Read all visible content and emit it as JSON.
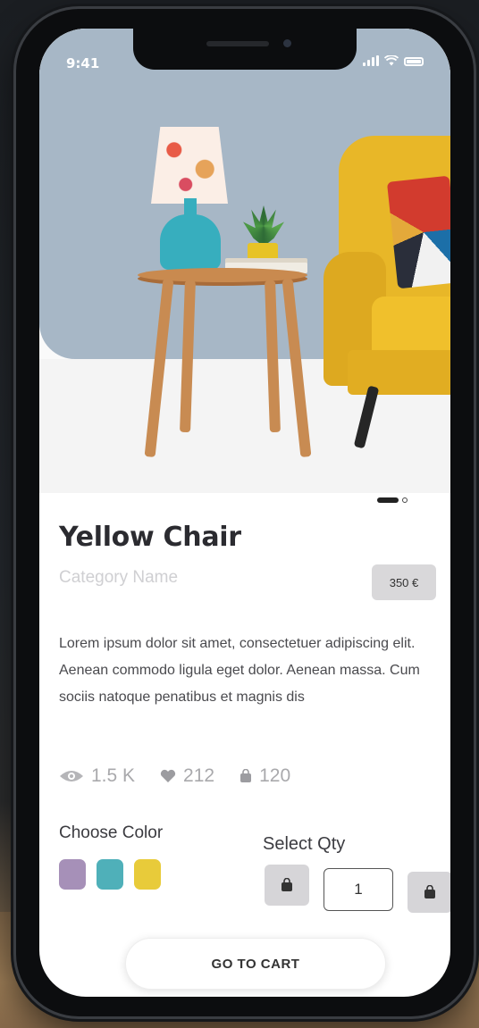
{
  "status_bar": {
    "time": "9:41"
  },
  "product": {
    "title": "Yellow Chair",
    "category": "Category Name",
    "price": "350 €",
    "description": "Lorem ipsum dolor sit amet, consectetuer adipiscing elit. Aenean commodo ligula eget dolor. Aenean massa. Cum sociis natoque penatibus et magnis dis"
  },
  "carousel": {
    "active_index": 0,
    "count": 2
  },
  "stats": {
    "views": "1.5 K",
    "likes": "212",
    "cart": "120"
  },
  "color_picker": {
    "label": "Choose Color",
    "colors": [
      "#a690b8",
      "#4fb0b9",
      "#e8cb3a"
    ]
  },
  "quantity": {
    "label": "Select Qty",
    "value": "1"
  },
  "cart_button": {
    "label": "GO TO CART"
  },
  "icons": [
    "eye-icon",
    "heart-icon",
    "bag-icon"
  ]
}
